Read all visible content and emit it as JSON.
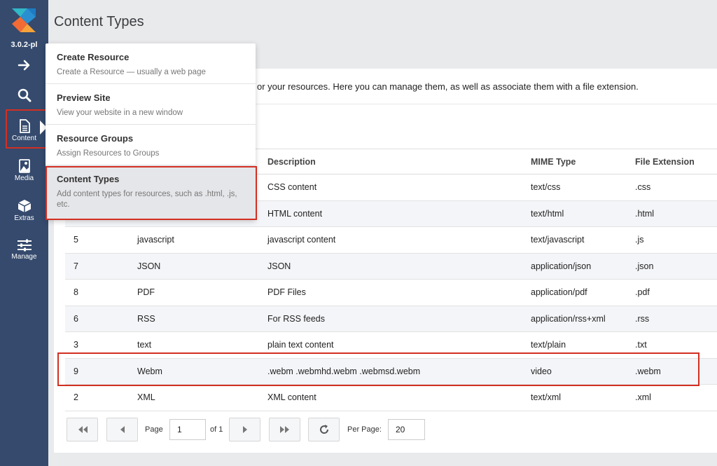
{
  "app": {
    "version": "3.0.2-pl",
    "colors": {
      "sidebar": "#354a6d",
      "highlight": "#d22f22",
      "logo_teal": "#31b7c8",
      "logo_orange": "#f26b35",
      "logo_blue": "#1e7bc3"
    }
  },
  "sidebar": {
    "items": [
      {
        "icon": "arrow-right-icon",
        "label": ""
      },
      {
        "icon": "search-icon",
        "label": ""
      },
      {
        "icon": "document-icon",
        "label": "Content"
      },
      {
        "icon": "image-icon",
        "label": "Media"
      },
      {
        "icon": "cube-icon",
        "label": "Extras"
      },
      {
        "icon": "sliders-icon",
        "label": "Manage"
      }
    ]
  },
  "page": {
    "title": "Content Types",
    "intro": "or your resources. Here you can manage them, as well as associate them with a file extension."
  },
  "dropdown": {
    "items": [
      {
        "title": "Create Resource",
        "desc": "Create a Resource — usually a web page"
      },
      {
        "title": "Preview Site",
        "desc": "View your website in a new window"
      },
      {
        "title": "Resource Groups",
        "desc": "Assign Resources to Groups"
      },
      {
        "title": "Content Types",
        "desc": "Add content types for resources, such as .html, .js, etc."
      }
    ]
  },
  "grid": {
    "headers": [
      "",
      "",
      "Description",
      "MIME Type",
      "File Extension"
    ],
    "rows": [
      [
        "",
        "",
        "CSS content",
        "text/css",
        ".css"
      ],
      [
        "",
        "",
        "HTML content",
        "text/html",
        ".html"
      ],
      [
        "5",
        "javascript",
        "javascript content",
        "text/javascript",
        ".js"
      ],
      [
        "7",
        "JSON",
        "JSON",
        "application/json",
        ".json"
      ],
      [
        "8",
        "PDF",
        "PDF Files",
        "application/pdf",
        ".pdf"
      ],
      [
        "6",
        "RSS",
        "For RSS feeds",
        "application/rss+xml",
        ".rss"
      ],
      [
        "3",
        "text",
        "plain text content",
        "text/plain",
        ".txt"
      ],
      [
        "9",
        "Webm",
        ".webm .webmhd.webm .webmsd.webm",
        "video",
        ".webm"
      ],
      [
        "2",
        "XML",
        "XML content",
        "text/xml",
        ".xml"
      ]
    ]
  },
  "pagination": {
    "page_label": "Page",
    "page_value": "1",
    "of_label": "of 1",
    "per_page_label": "Per Page:",
    "per_page_value": "20",
    "buttons": [
      "first-page-icon",
      "prev-page-icon",
      "next-page-icon",
      "last-page-icon",
      "refresh-icon"
    ]
  }
}
